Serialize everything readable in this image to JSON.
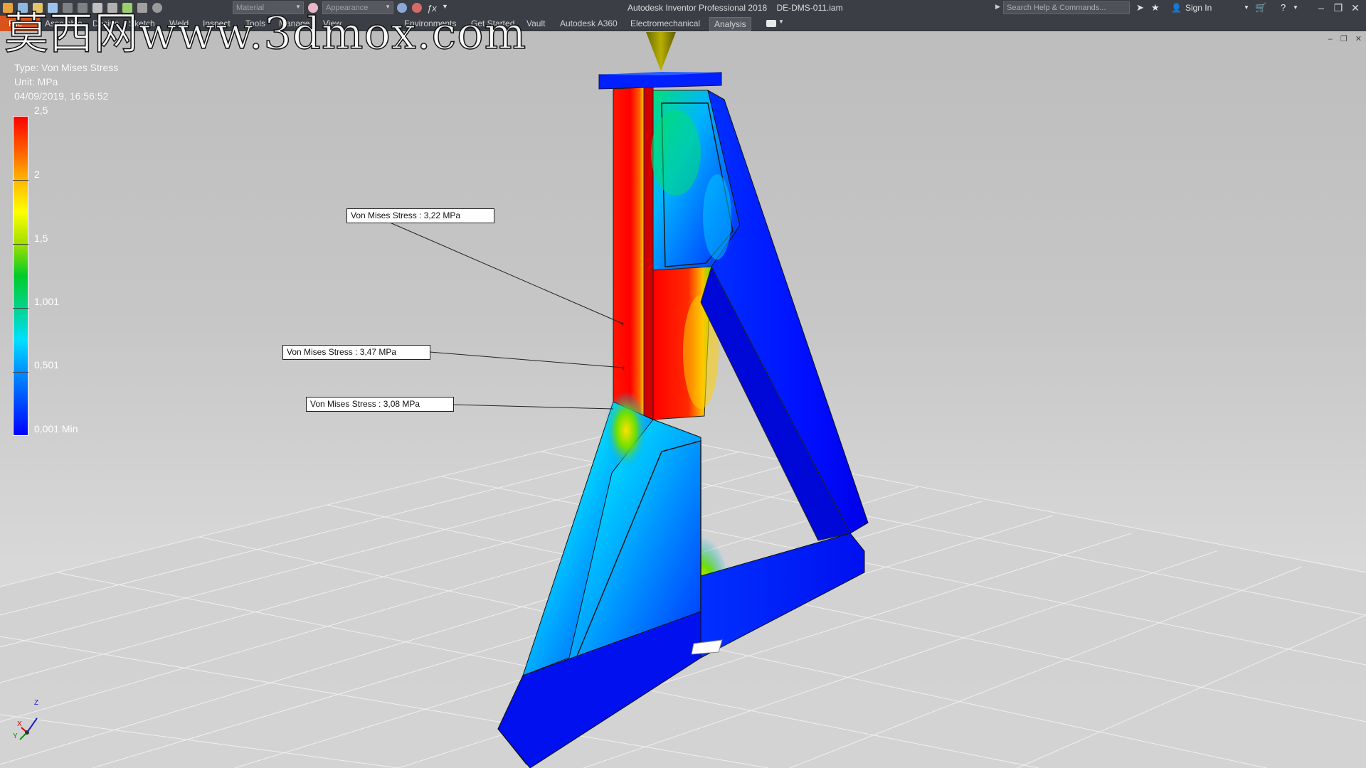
{
  "app": {
    "title": "Autodesk Inventor Professional 2018",
    "document": "DE-DMS-011.iam"
  },
  "quick_access": {
    "material_placeholder": "Material",
    "appearance_placeholder": "Appearance"
  },
  "search": {
    "placeholder": "Search Help & Commands..."
  },
  "account": {
    "sign_in": "Sign In"
  },
  "ribbon": {
    "tabs": [
      {
        "label": "File"
      },
      {
        "label": "Assemble"
      },
      {
        "label": "Design"
      },
      {
        "label": "Sketch"
      },
      {
        "label": "Weld"
      },
      {
        "label": "Inspect"
      },
      {
        "label": "Tools"
      },
      {
        "label": "Manage"
      },
      {
        "label": "View"
      },
      {
        "label": "Environments"
      },
      {
        "label": "Get Started"
      },
      {
        "label": "Vault"
      },
      {
        "label": "Autodesk A360"
      },
      {
        "label": "Electromechanical"
      },
      {
        "label": "Analysis"
      }
    ],
    "active_tab": "Analysis"
  },
  "legend": {
    "type": "Type: Von Mises Stress",
    "unit": "Unit: MPa",
    "timestamp": "04/09/2019, 16:56:52",
    "values": [
      "2,5",
      "2",
      "1,5",
      "1,001",
      "0,501",
      "0,001 Min"
    ],
    "max_color": "#ff0000",
    "min_color": "#0000ff"
  },
  "probes": [
    {
      "label": "Von Mises Stress : 3,22 MPa"
    },
    {
      "label": "Von Mises Stress : 3,47 MPa"
    },
    {
      "label": "Von Mises Stress : 3,08 MPa"
    }
  ],
  "axis": {
    "z": "Z",
    "x": "X",
    "y": "Y"
  },
  "watermark": "莫西网www.3dmox.com",
  "icons": {
    "app_menu": "inventor-logo-icon",
    "help": "help-icon",
    "cart": "cart-icon",
    "star": "favorites-icon",
    "user": "user-icon"
  }
}
